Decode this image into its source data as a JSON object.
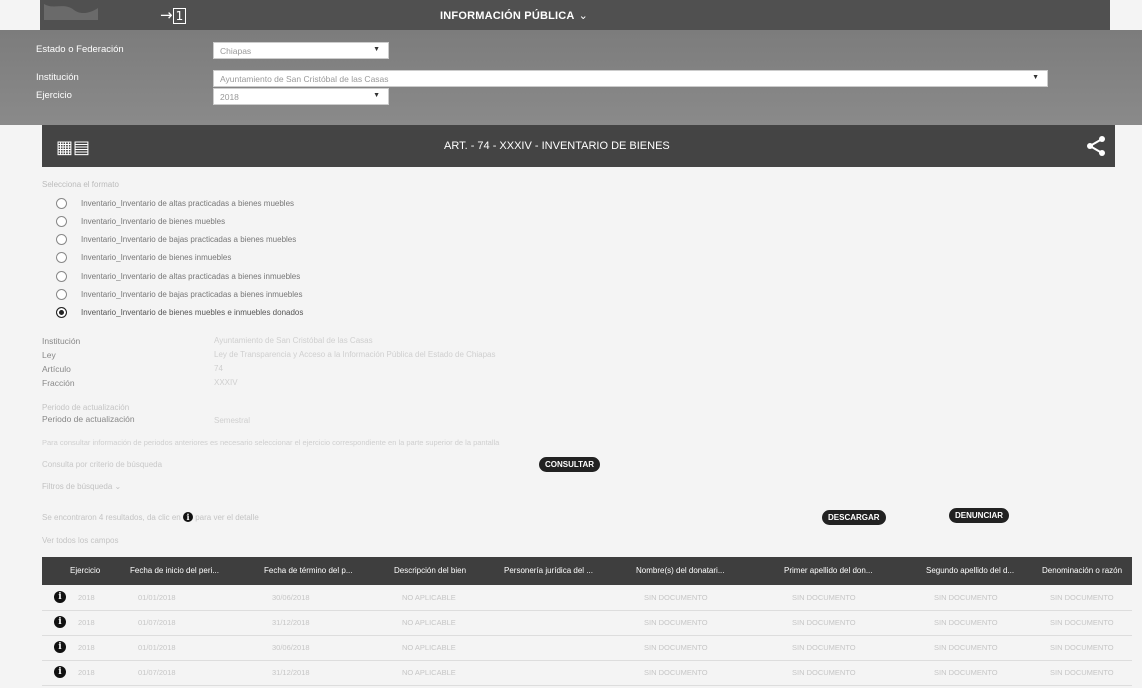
{
  "header": {
    "collapse_icon": "→",
    "title": "INFORMACIÓN PÚBLICA",
    "title_chevron": "⌄"
  },
  "filters": {
    "state_label": "Estado o Federación",
    "state_value": "Chiapas",
    "institution_label": "Institución",
    "institution_value": "Ayuntamiento de San Cristóbal de las Casas",
    "year_label": "Ejercicio",
    "year_value": "2018"
  },
  "article": {
    "title": "ART. - 74 - XXXIV - INVENTARIO DE BIENES"
  },
  "formats": {
    "heading": "Selecciona el formato",
    "items": [
      {
        "label": "Inventario_Inventario de altas practicadas a bienes muebles",
        "selected": false
      },
      {
        "label": "Inventario_Inventario de bienes muebles",
        "selected": false
      },
      {
        "label": "Inventario_Inventario de bajas practicadas a bienes muebles",
        "selected": false
      },
      {
        "label": "Inventario_Inventario de bienes inmuebles",
        "selected": false
      },
      {
        "label": "Inventario_Inventario de altas practicadas a bienes inmuebles",
        "selected": false
      },
      {
        "label": "Inventario_Inventario de bajas practicadas a bienes inmuebles",
        "selected": false
      },
      {
        "label": "Inventario_Inventario de bienes muebles e inmuebles donados",
        "selected": true
      }
    ]
  },
  "info": {
    "institution_label": "Institución",
    "institution_value": "Ayuntamiento de San Cristóbal de las Casas",
    "law_label": "Ley",
    "law_value": "Ley de Transparencia y Acceso a la Información Pública del Estado de Chiapas",
    "article_label": "Artículo",
    "article_value": "74",
    "fraction_label": "Fracción",
    "fraction_value": "XXXIV",
    "period_heading": "Periodo de actualización",
    "period_label": "Periodo de actualización",
    "period_value": "Semestral",
    "note": "Para consultar información de periodos anteriores es necesario seleccionar el ejercicio correspondiente en la parte superior de la pantalla",
    "query_hint": "Consulta por criterio de búsqueda",
    "consult_button": "CONSULTAR",
    "advanced_filters": "Filtros de búsqueda ⌄"
  },
  "results": {
    "summary": "Se encontraron 4 resultados, da clic en ",
    "summary_icon": "i",
    "summary_tail": " para ver el detalle",
    "download_button": "DESCARGAR",
    "report_button": "DENUNCIAR",
    "view_label": "Ver todos los campos"
  },
  "table": {
    "columns": [
      "Ejercicio",
      "Fecha de inicio del peri...",
      "Fecha de término del p...",
      "Descripción del bien",
      "Personería jurídica del ...",
      "Nombre(s) del donatari...",
      "Primer apellido del don...",
      "Segundo apellido del d...",
      "Denominación o razón"
    ],
    "rows": [
      [
        "2018",
        "01/01/2018",
        "30/06/2018",
        "NO APLICABLE",
        "",
        "SIN DOCUMENTO",
        "SIN DOCUMENTO",
        "SIN DOCUMENTO",
        "SIN DOCUMENTO"
      ],
      [
        "2018",
        "01/07/2018",
        "31/12/2018",
        "NO APLICABLE",
        "",
        "SIN DOCUMENTO",
        "SIN DOCUMENTO",
        "SIN DOCUMENTO",
        "SIN DOCUMENTO"
      ],
      [
        "2018",
        "01/01/2018",
        "30/06/2018",
        "NO APLICABLE",
        "",
        "SIN DOCUMENTO",
        "SIN DOCUMENTO",
        "SIN DOCUMENTO",
        "SIN DOCUMENTO"
      ],
      [
        "2018",
        "01/07/2018",
        "31/12/2018",
        "NO APLICABLE",
        "",
        "SIN DOCUMENTO",
        "SIN DOCUMENTO",
        "SIN DOCUMENTO",
        "SIN DOCUMENTO"
      ]
    ]
  }
}
